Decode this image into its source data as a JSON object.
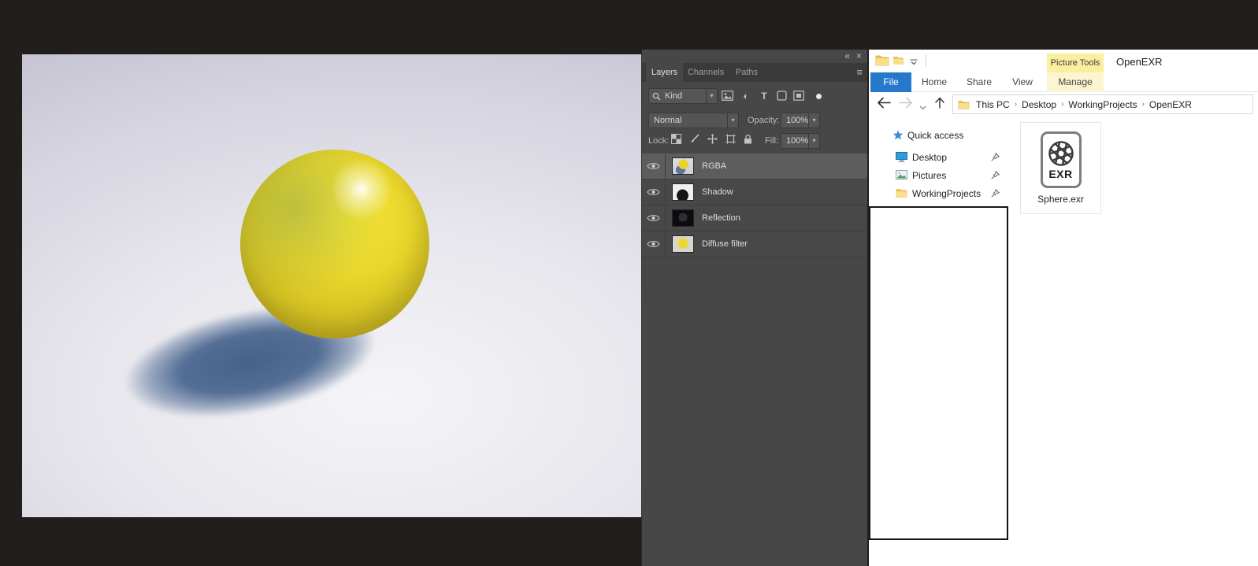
{
  "photoshop": {
    "panel": {
      "tabs": [
        "Layers",
        "Channels",
        "Paths"
      ],
      "kind_label": "Kind",
      "blend_mode": "Normal",
      "opacity_label": "Opacity:",
      "opacity_value": "100%",
      "lock_label": "Lock:",
      "fill_label": "Fill:",
      "fill_value": "100%",
      "layers": [
        {
          "name": "RGBA",
          "selected": true
        },
        {
          "name": "Shadow",
          "selected": false
        },
        {
          "name": "Reflection",
          "selected": false
        },
        {
          "name": "Diffuse filter",
          "selected": false
        }
      ]
    }
  },
  "explorer": {
    "window_title": "OpenEXR",
    "contextual_tab": "Picture Tools",
    "ribbon_tabs": {
      "file": "File",
      "home": "Home",
      "share": "Share",
      "view": "View",
      "manage": "Manage"
    },
    "breadcrumb": {
      "separator": "›",
      "items": [
        "This PC",
        "Desktop",
        "WorkingProjects",
        "OpenEXR"
      ]
    },
    "sidebar": {
      "quick_access": "Quick access",
      "items": [
        {
          "label": "Desktop"
        },
        {
          "label": "Pictures"
        },
        {
          "label": "WorkingProjects"
        }
      ]
    },
    "files": [
      {
        "name": "Sphere.exr",
        "badge": "EXR"
      }
    ]
  },
  "icons": {
    "collapse_panels": "«",
    "close": "×",
    "panel_menu": "≡",
    "dropdown_arrow": "▾",
    "type_tool": "T",
    "adjustment": "◐"
  },
  "colors": {
    "ps_workspace_bg": "#211e1b",
    "ps_panel_bg": "#474747",
    "ps_selected_layer": "#5d5d5d",
    "explorer_file_tab_blue": "#2679ca",
    "picture_tools_yellow": "#f9ef9e",
    "sphere_yellow": "#e9d62b",
    "shadow_blue": "#3e5c86"
  }
}
